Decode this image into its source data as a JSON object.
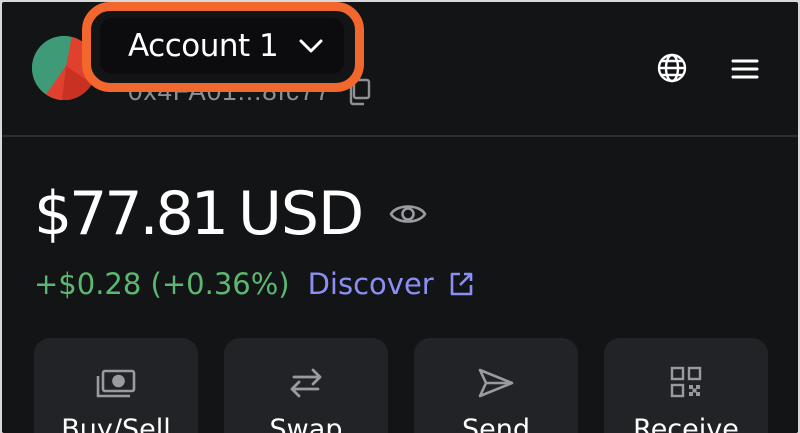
{
  "header": {
    "account_name": "Account 1",
    "address": "0x4FA01...8fc77",
    "icons": {
      "avatar": "account-avatar",
      "dropdown": "chevron-down-icon",
      "copy": "copy-icon",
      "network": "globe-icon",
      "menu": "hamburger-menu-icon"
    }
  },
  "balance": {
    "amount": "$77.81",
    "currency": "USD",
    "visibility_icon": "eye-icon"
  },
  "change": {
    "text": "+$0.28 (+0.36%)",
    "discover_label": "Discover",
    "discover_icon": "external-link-icon"
  },
  "actions": [
    {
      "label": "Buy/Sell",
      "icon": "cash-icon"
    },
    {
      "label": "Swap",
      "icon": "swap-arrows-icon"
    },
    {
      "label": "Send",
      "icon": "send-icon"
    },
    {
      "label": "Receive",
      "icon": "qr-code-icon"
    }
  ],
  "colors": {
    "background": "#131416",
    "highlight": "#f2672e",
    "positive": "#5bb870",
    "link": "#8b8ff5",
    "card": "#222326"
  }
}
